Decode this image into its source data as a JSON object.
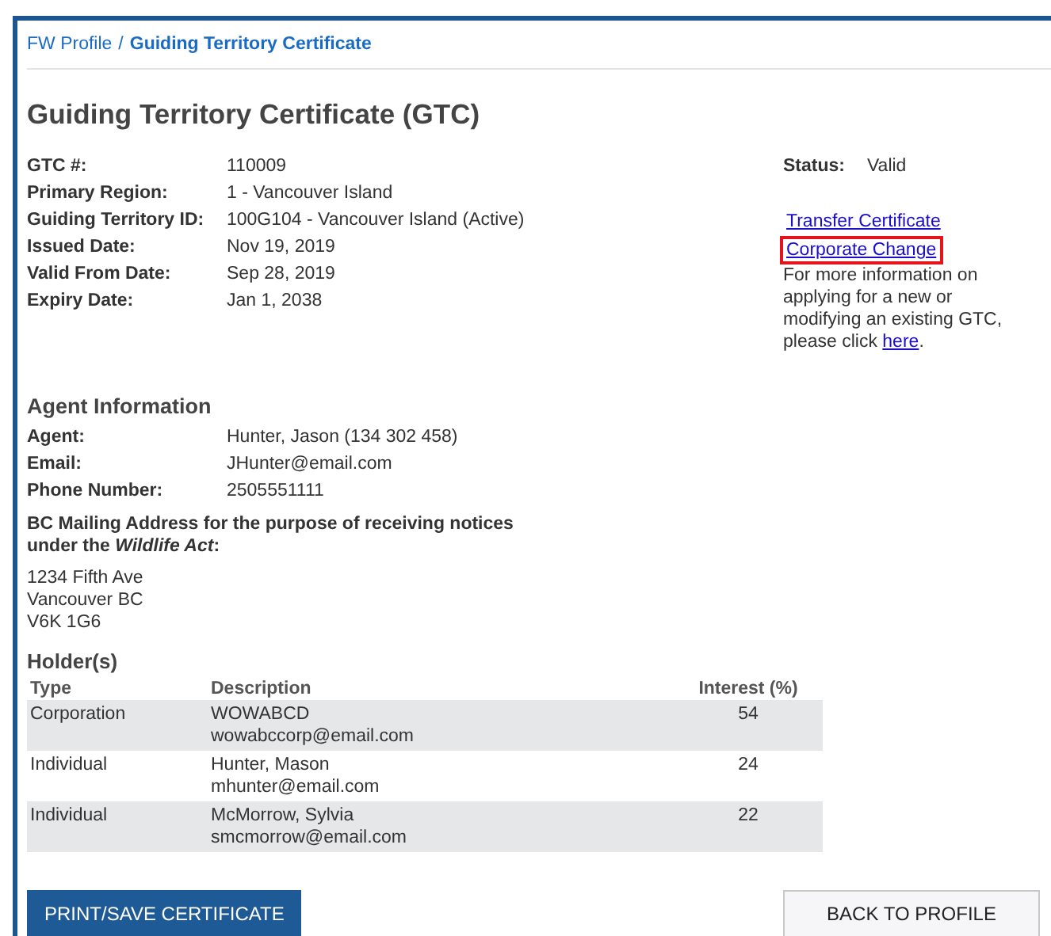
{
  "breadcrumb": {
    "parent": "FW Profile",
    "separator": "/",
    "current": "Guiding Territory Certificate"
  },
  "title": "Guiding Territory Certificate (GTC)",
  "fields": [
    {
      "label": "GTC #:",
      "value": "110009"
    },
    {
      "label": "Primary Region:",
      "value": "1 - Vancouver Island"
    },
    {
      "label": "Guiding Territory ID:",
      "value": "100G104 - Vancouver Island (Active)"
    },
    {
      "label": "Issued Date:",
      "value": "Nov 19, 2019"
    },
    {
      "label": "Valid From Date:",
      "value": "Sep 28, 2019"
    },
    {
      "label": "Expiry Date:",
      "value": "Jan 1, 2038"
    }
  ],
  "status": {
    "label": "Status:",
    "value": "Valid"
  },
  "actions": [
    {
      "label": "Transfer Certificate",
      "highlighted": false
    },
    {
      "label": "Corporate Change",
      "highlighted": true
    }
  ],
  "info": {
    "text": "For more information on applying for a new or modifying an existing GTC, please click",
    "link": "here",
    "end": "."
  },
  "agent": {
    "heading": "Agent Information",
    "fields": [
      {
        "label": "Agent:",
        "value": "Hunter, Jason (134 302 458)"
      },
      {
        "label": "Email:",
        "value": "JHunter@email.com"
      },
      {
        "label": "Phone Number:",
        "value": "2505551111"
      }
    ],
    "address_label": "BC Mailing Address for the purpose of receiving notices under the *Wildlife Act*:",
    "address_lines": [
      "1234 Fifth Ave",
      "Vancouver BC",
      "V6K 1G6"
    ]
  },
  "holders": {
    "heading": "Holder(s)",
    "columns": [
      "Type",
      "Description",
      "Interest (%)"
    ],
    "rows": [
      {
        "type": "Corporation",
        "name": "WOWABCD",
        "email": "wowabccorp@email.com",
        "interest": "54"
      },
      {
        "type": "Individual",
        "name": "Hunter, Mason",
        "email": "mhunter@email.com",
        "interest": "24"
      },
      {
        "type": "Individual",
        "name": "McMorrow, Sylvia",
        "email": "smcmorrow@email.com",
        "interest": "22"
      }
    ]
  },
  "buttons": {
    "primary": "PRINT/SAVE CERTIFICATE",
    "secondary": "BACK TO PROFILE"
  }
}
